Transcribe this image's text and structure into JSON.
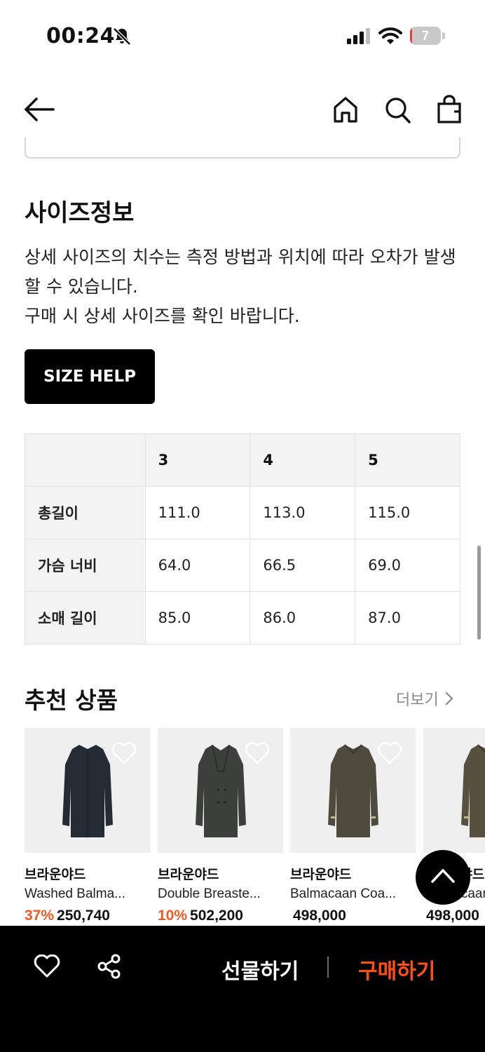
{
  "status_bar": {
    "time": "00:24",
    "battery_level": "7",
    "icons": [
      "bell-slash-icon",
      "cellular-signal-icon",
      "wifi-icon",
      "battery-icon"
    ]
  },
  "nav": {
    "icons": [
      "back-arrow-icon",
      "home-icon",
      "search-icon",
      "shopping-bag-icon"
    ]
  },
  "size_info": {
    "title": "사이즈정보",
    "description_lines": [
      "상세 사이즈의 치수는 측정 방법과 위치에 따라 오차가 발생할 수 있습니다.",
      "구매 시 상세 사이즈를 확인 바랍니다."
    ],
    "help_button": "SIZE HELP",
    "table": {
      "headers": [
        "",
        "3",
        "4",
        "5"
      ],
      "rows": [
        {
          "label": "총길이",
          "values": [
            "111.0",
            "113.0",
            "115.0"
          ]
        },
        {
          "label": "가슴 너비",
          "values": [
            "64.0",
            "66.5",
            "69.0"
          ]
        },
        {
          "label": "소매 길이",
          "values": [
            "85.0",
            "86.0",
            "87.0"
          ]
        }
      ]
    }
  },
  "recommended": {
    "title": "추천 상품",
    "more_label": "더보기",
    "products": [
      {
        "brand": "브라운야드",
        "name": "Washed Balma...",
        "discount": "37%",
        "price": "250,740",
        "coat_color": "#252b35"
      },
      {
        "brand": "브라운야드",
        "name": "Double Breaste...",
        "discount": "10%",
        "price": "502,200",
        "coat_color": "#3d3f3c"
      },
      {
        "brand": "브라운야드",
        "name": "Balmacaan Coa...",
        "discount": "",
        "price": "498,000",
        "coat_color": "#4f4a3e"
      },
      {
        "brand": "브라운야드",
        "name": "Balmacaan Coa...",
        "discount": "",
        "price": "498,000",
        "coat_color": "#57503f"
      }
    ]
  },
  "bottom_bar": {
    "gift_label": "선물하기",
    "buy_label": "구매하기",
    "accent_color": "#ff4e12"
  },
  "colors": {
    "discount": "#f25a22",
    "more_link": "#8a8a8a"
  }
}
